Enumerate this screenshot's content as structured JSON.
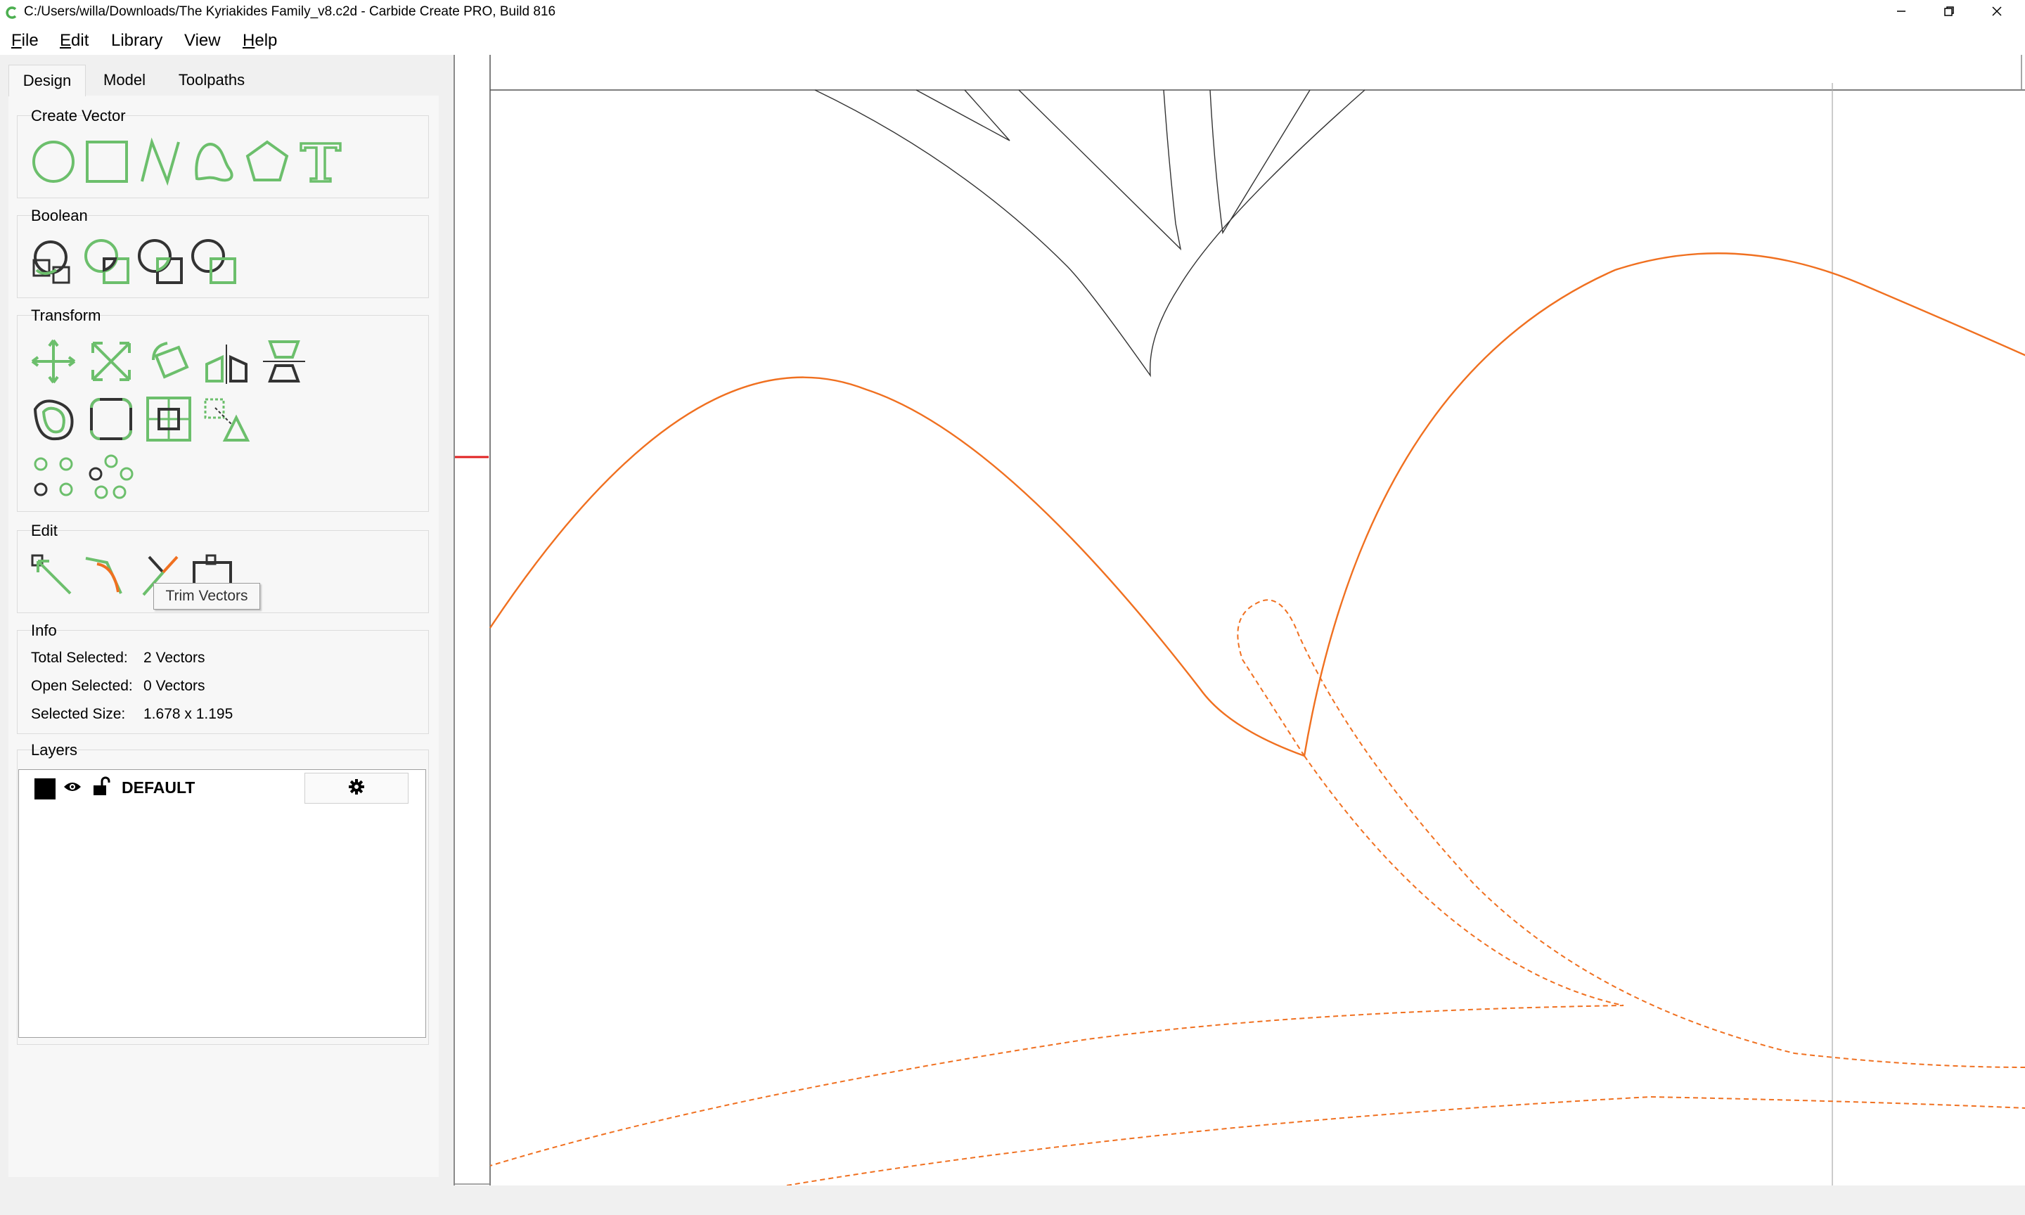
{
  "window": {
    "title": "C:/Users/willa/Downloads/The Kyriakides Family_v8.c2d - Carbide Create PRO, Build 816",
    "app_icon": "carbide-c-icon",
    "controls": [
      "minimize-icon",
      "restore-icon",
      "close-icon"
    ]
  },
  "menu": [
    {
      "label": "File",
      "accel": "F",
      "rest": "ile"
    },
    {
      "label": "Edit",
      "accel": "E",
      "rest": "dit"
    },
    {
      "label": "Library",
      "accel": "",
      "rest": "Library"
    },
    {
      "label": "View",
      "accel": "",
      "rest": "View"
    },
    {
      "label": "Help",
      "accel": "H",
      "rest": "elp"
    }
  ],
  "tabs": [
    {
      "label": "Design",
      "active": true
    },
    {
      "label": "Model",
      "active": false
    },
    {
      "label": "Toolpaths",
      "active": false
    }
  ],
  "sections": {
    "create_vector": {
      "title": "Create Vector",
      "tools": [
        "circle-icon",
        "rectangle-icon",
        "polyline-icon",
        "curve-icon",
        "polygon-icon",
        "text-icon"
      ]
    },
    "boolean": {
      "title": "Boolean",
      "tools": [
        "boolean-union-icon",
        "boolean-subtract-icon",
        "boolean-intersect-icon",
        "boolean-trim-icon"
      ]
    },
    "transform": {
      "title": "Transform",
      "tools": [
        "move-icon",
        "scale-icon",
        "rotate-icon",
        "mirror-icon",
        "align-icon",
        "offset-icon",
        "fillet-icon",
        "center-icon",
        "transform-icon",
        "grid-array-icon",
        "circular-array-icon"
      ]
    },
    "edit": {
      "title": "Edit",
      "tools": [
        "node-edit-icon",
        "join-vectors-icon",
        "trim-vectors-icon",
        "close-vectors-icon"
      ],
      "tooltip": "Trim Vectors"
    },
    "info": {
      "title": "Info",
      "rows": [
        {
          "label": "Total Selected:",
          "value": "2 Vectors"
        },
        {
          "label": "Open Selected:",
          "value": "0 Vectors"
        },
        {
          "label": "Selected Size:",
          "value": "1.678 x 1.195"
        }
      ]
    },
    "layers": {
      "title": "Layers",
      "items": [
        {
          "name": "DEFAULT",
          "color": "#000000",
          "visible": true,
          "locked": false
        }
      ],
      "settings_icon": "gear-icon"
    }
  },
  "colors": {
    "accent_green": "#6cbf6c",
    "selected_orange": "#f07020",
    "canvas_bg": "#ffffff",
    "panel_bg": "#f7f7f7"
  }
}
